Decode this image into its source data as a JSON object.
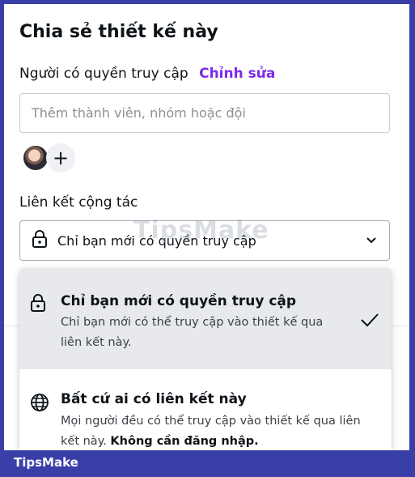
{
  "dialog": {
    "title": "Chia sẻ thiết kế này",
    "access_label": "Người có quyền truy cập",
    "edit_link": "Chỉnh sửa",
    "invite_placeholder": "Thêm thành viên, nhóm hoặc đội",
    "add_member_symbol": "+",
    "collab_label": "Liên kết cộng tác",
    "link_select_value": "Chỉ bạn mới có quyền truy cập"
  },
  "dropdown": {
    "options": [
      {
        "title": "Chỉ bạn mới có quyền truy cập",
        "desc": "Chỉ bạn mới có thể truy cập vào thiết kế qua liên kết này.",
        "icon": "lock-icon",
        "selected": true
      },
      {
        "title": "Bất cứ ai có liên kết này",
        "desc": "Mọi người đều có thể truy cập vào thiết kế qua liên kết này.",
        "desc_bold": "Không cần đăng nhập.",
        "icon": "globe-icon",
        "selected": false
      }
    ]
  },
  "watermark": "TipsMake",
  "footer": {
    "logo": "TipsMake"
  },
  "colors": {
    "accent": "#7d2ae8",
    "frame": "#3a3fa8",
    "selected_bg": "#e7e9ed"
  }
}
